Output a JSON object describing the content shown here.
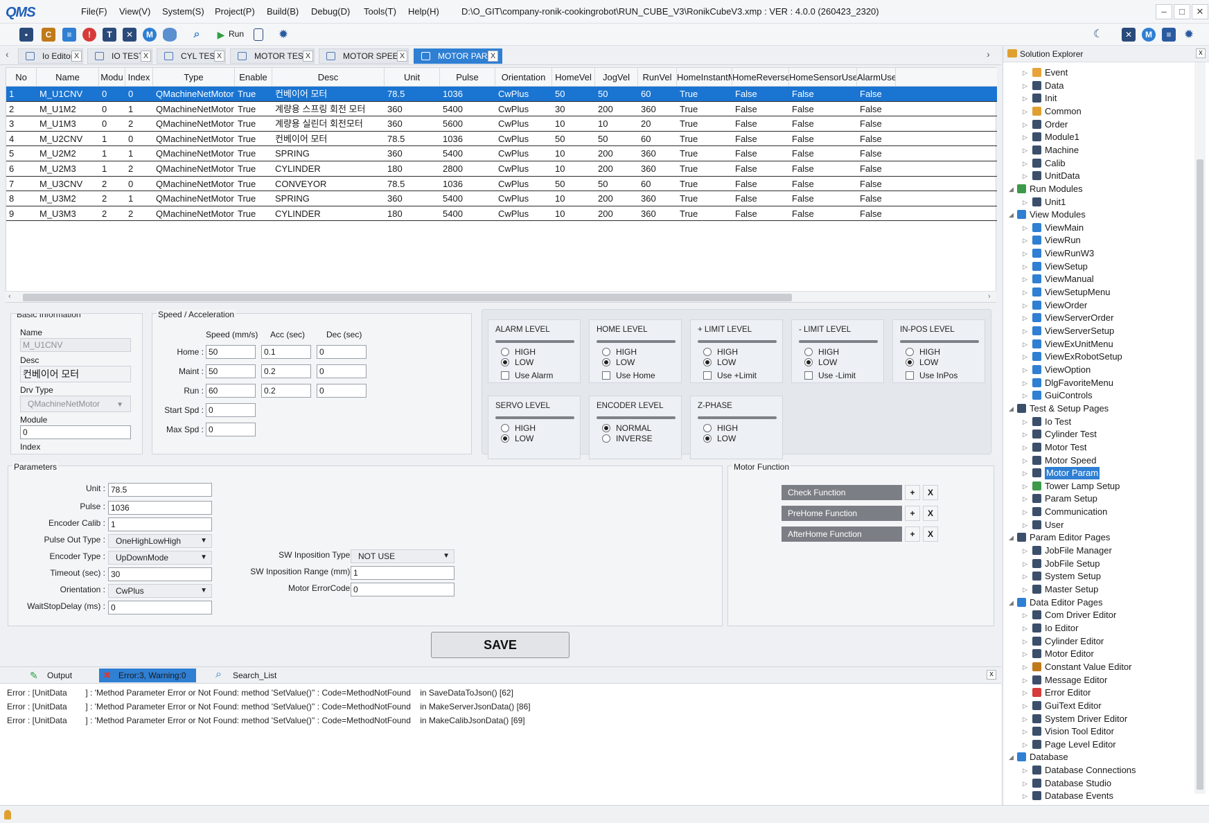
{
  "app": {
    "logo_text": "QMS",
    "title": "D:\\O_GIT\\company-ronik-cookingrobot\\RUN_CUBE_V3\\RonikCubeV3.xmp :  VER : 4.0.0 (260423_2320)",
    "menu": [
      "File(F)",
      "View(V)",
      "System(S)",
      "Project(P)",
      "Build(B)",
      "Debug(D)",
      "Tools(T)",
      "Help(H)"
    ],
    "window_buttons": [
      "–",
      "□",
      "✕"
    ],
    "accent_color": "#2f7fd3"
  },
  "toolbar": {
    "run_label": "Run",
    "icons": [
      "save-icon",
      "constant-icon",
      "message-icon",
      "error-icon",
      "text-icon",
      "close-box-icon",
      "motor-icon",
      "database-icon",
      "search-icon",
      "run-icon",
      "export-icon",
      "gear-icon"
    ],
    "right_icons": [
      "moon-icon",
      "close-box-icon",
      "motor-icon",
      "document-icon",
      "gear-icon"
    ]
  },
  "tabs": [
    {
      "label": "Io Editor",
      "close": "X"
    },
    {
      "label": "IO TEST",
      "close": "X"
    },
    {
      "label": "CYL TEST",
      "close": "X"
    },
    {
      "label": "MOTOR TEST",
      "close": "X"
    },
    {
      "label": "MOTOR SPEED",
      "close": "X"
    },
    {
      "label": "MOTOR PARA",
      "close": "X"
    }
  ],
  "grid": {
    "columns": [
      "No",
      "Name",
      "Modu",
      "Index",
      "Type",
      "Enable",
      "Desc",
      "Unit",
      "Pulse",
      "Orientation",
      "HomeVel",
      "JogVel",
      "RunVel",
      "HomeInstantM",
      "HomeReverse",
      "HomeSensorUse",
      "AlarmUse"
    ],
    "rows": [
      [
        "1",
        "M_U1CNV",
        "0",
        "0",
        "QMachineNetMotor",
        "True",
        "컨베이어 모터",
        "78.5",
        "1036",
        "CwPlus",
        "50",
        "50",
        "60",
        "True",
        "False",
        "False",
        "False"
      ],
      [
        "2",
        "M_U1M2",
        "0",
        "1",
        "QMachineNetMotor",
        "True",
        "계량용 스프링 회전 모터",
        "360",
        "5400",
        "CwPlus",
        "30",
        "200",
        "360",
        "True",
        "False",
        "False",
        "False"
      ],
      [
        "3",
        "M_U1M3",
        "0",
        "2",
        "QMachineNetMotor",
        "True",
        "계량용 실린더 회전모터",
        "360",
        "5600",
        "CwPlus",
        "10",
        "10",
        "20",
        "True",
        "False",
        "False",
        "False"
      ],
      [
        "4",
        "M_U2CNV",
        "1",
        "0",
        "QMachineNetMotor",
        "True",
        "컨베이어 모터",
        "78.5",
        "1036",
        "CwPlus",
        "50",
        "50",
        "60",
        "True",
        "False",
        "False",
        "False"
      ],
      [
        "5",
        "M_U2M2",
        "1",
        "1",
        "QMachineNetMotor",
        "True",
        "SPRING",
        "360",
        "5400",
        "CwPlus",
        "10",
        "200",
        "360",
        "True",
        "False",
        "False",
        "False"
      ],
      [
        "6",
        "M_U2M3",
        "1",
        "2",
        "QMachineNetMotor",
        "True",
        "CYLINDER",
        "180",
        "2800",
        "CwPlus",
        "10",
        "200",
        "360",
        "True",
        "False",
        "False",
        "False"
      ],
      [
        "7",
        "M_U3CNV",
        "2",
        "0",
        "QMachineNetMotor",
        "True",
        "CONVEYOR",
        "78.5",
        "1036",
        "CwPlus",
        "50",
        "50",
        "60",
        "True",
        "False",
        "False",
        "False"
      ],
      [
        "8",
        "M_U3M2",
        "2",
        "1",
        "QMachineNetMotor",
        "True",
        "SPRING",
        "360",
        "5400",
        "CwPlus",
        "10",
        "200",
        "360",
        "True",
        "False",
        "False",
        "False"
      ],
      [
        "9",
        "M_U3M3",
        "2",
        "2",
        "QMachineNetMotor",
        "True",
        "CYLINDER",
        "180",
        "5400",
        "CwPlus",
        "10",
        "200",
        "360",
        "True",
        "False",
        "False",
        "False"
      ]
    ]
  },
  "basic": {
    "title": "Basic Information",
    "name_label": "Name",
    "name_value": "M_U1CNV",
    "desc_label": "Desc",
    "desc_value": "컨베이어 모터",
    "drv_label": "Drv Type",
    "drv_value": "QMachineNetMotor",
    "module_label": "Module",
    "module_value": "0",
    "index_label": "Index"
  },
  "speed": {
    "title": "Speed / Acceleration",
    "col_speed": "Speed (mm/s)",
    "col_acc": "Acc (sec)",
    "col_dec": "Dec (sec)",
    "rows": [
      {
        "label": "Home :",
        "speed": "50",
        "acc": "0.1",
        "dec": "0"
      },
      {
        "label": "Maint :",
        "speed": "50",
        "acc": "0.2",
        "dec": "0"
      },
      {
        "label": "Run :",
        "speed": "60",
        "acc": "0.2",
        "dec": "0"
      }
    ],
    "start_label": "Start Spd :",
    "start_value": "0",
    "max_label": "Max Spd :",
    "max_value": "0"
  },
  "levels": [
    {
      "title": "ALARM LEVEL",
      "opt1": "HIGH",
      "opt2": "LOW",
      "selected": 2,
      "check": "Use Alarm"
    },
    {
      "title": "HOME LEVEL",
      "opt1": "HIGH",
      "opt2": "LOW",
      "selected": 2,
      "check": "Use Home"
    },
    {
      "title": "+ LIMIT LEVEL",
      "opt1": "HIGH",
      "opt2": "LOW",
      "selected": 2,
      "check": "Use +Limit"
    },
    {
      "title": "- LIMIT LEVEL",
      "opt1": "HIGH",
      "opt2": "LOW",
      "selected": 2,
      "check": "Use -Limit"
    },
    {
      "title": "IN-POS LEVEL",
      "opt1": "HIGH",
      "opt2": "LOW",
      "selected": 2,
      "check": "Use InPos"
    },
    {
      "title": "SERVO LEVEL",
      "opt1": "HIGH",
      "opt2": "LOW",
      "selected": 2,
      "check": ""
    },
    {
      "title": "ENCODER LEVEL",
      "opt1": "NORMAL",
      "opt2": "INVERSE",
      "selected": 1,
      "check": ""
    },
    {
      "title": "Z-PHASE",
      "opt1": "HIGH",
      "opt2": "LOW",
      "selected": 2,
      "check": ""
    }
  ],
  "params": {
    "title": "Parameters",
    "unit_label": "Unit :",
    "unit_value": "78.5",
    "pulse_label": "Pulse :",
    "pulse_value": "1036",
    "enc_calib_label": "Encoder Calib :",
    "enc_calib_value": "1",
    "pulse_out_label": "Pulse Out Type :",
    "pulse_out_value": "OneHighLowHigh",
    "enc_type_label": "Encoder Type :",
    "enc_type_value": "UpDownMode",
    "timeout_label": "Timeout (sec) :",
    "timeout_value": "30",
    "orient_label": "Orientation :",
    "orient_value": "CwPlus",
    "wait_label": "WaitStopDelay (ms) :",
    "wait_value": "0",
    "sw_type_label": "SW Inposition Type :",
    "sw_type_value": "NOT USE",
    "sw_range_label": "SW Inposition Range (mm) :",
    "sw_range_value": "1",
    "err_label": "Motor ErrorCode :",
    "err_value": "0"
  },
  "motor_function": {
    "title": "Motor Function",
    "items": [
      "Check Function",
      "PreHome Function",
      "AfterHome Function"
    ],
    "add": "+",
    "remove": "X"
  },
  "save_label": "SAVE",
  "output": {
    "tabs": [
      "Output",
      "Error:3, Warning:0",
      "Search_List"
    ],
    "close": "x",
    "lines": [
      "Error : [UnitData        ] : 'Method Parameter Error or Not Found: method 'SetValue()'' : Code=MethodNotFound    in SaveDataToJson() [62]",
      "Error : [UnitData        ] : 'Method Parameter Error or Not Found: method 'SetValue()'' : Code=MethodNotFound    in MakeServerJsonData() [86]",
      "Error : [UnitData        ] : 'Method Parameter Error or Not Found: method 'SetValue()'' : Code=MethodNotFound    in MakeCalibJsonData() [69]"
    ]
  },
  "solution": {
    "title": "Solution Explorer",
    "close": "x",
    "items": [
      {
        "label": "Event",
        "icon": "lightning-icon",
        "color": "#e8a23a",
        "level": 1
      },
      {
        "label": "Data",
        "icon": "list-icon",
        "color": "#3b4f6b",
        "level": 1
      },
      {
        "label": "Init",
        "icon": "list-icon",
        "color": "#3b4f6b",
        "level": 1
      },
      {
        "label": "Common",
        "icon": "columns-icon",
        "color": "#e0a030",
        "level": 1
      },
      {
        "label": "Order",
        "icon": "list-icon",
        "color": "#3b4f6b",
        "level": 1
      },
      {
        "label": "Module1",
        "icon": "list-icon",
        "color": "#3b4f6b",
        "level": 1
      },
      {
        "label": "Machine",
        "icon": "list-icon",
        "color": "#3b4f6b",
        "level": 1
      },
      {
        "label": "Calib",
        "icon": "list-icon",
        "color": "#3b4f6b",
        "level": 1
      },
      {
        "label": "UnitData",
        "icon": "list-icon",
        "color": "#3b4f6b",
        "level": 1
      },
      {
        "label": "Run Modules",
        "icon": "check-folder-icon",
        "color": "#3d9a4a",
        "level": 0
      },
      {
        "label": "Unit1",
        "icon": "list-icon",
        "color": "#3b4f6b",
        "level": 1
      },
      {
        "label": "View Modules",
        "icon": "window-icon",
        "color": "#2f7fd3",
        "level": 0
      },
      {
        "label": "ViewMain",
        "icon": "window-icon",
        "color": "#2f7fd3",
        "level": 1
      },
      {
        "label": "ViewRun",
        "icon": "window-icon",
        "color": "#2f7fd3",
        "level": 1
      },
      {
        "label": "ViewRunW3",
        "icon": "window-icon",
        "color": "#2f7fd3",
        "level": 1
      },
      {
        "label": "ViewSetup",
        "icon": "window-icon",
        "color": "#2f7fd3",
        "level": 1
      },
      {
        "label": "ViewManual",
        "icon": "window-icon",
        "color": "#2f7fd3",
        "level": 1
      },
      {
        "label": "ViewSetupMenu",
        "icon": "window-icon",
        "color": "#2f7fd3",
        "level": 1
      },
      {
        "label": "ViewOrder",
        "icon": "window-icon",
        "color": "#2f7fd3",
        "level": 1
      },
      {
        "label": "ViewServerOrder",
        "icon": "window-icon",
        "color": "#2f7fd3",
        "level": 1
      },
      {
        "label": "ViewServerSetup",
        "icon": "window-icon",
        "color": "#2f7fd3",
        "level": 1
      },
      {
        "label": "ViewExUnitMenu",
        "icon": "window-icon",
        "color": "#2f7fd3",
        "level": 1
      },
      {
        "label": "ViewExRobotSetup",
        "icon": "window-icon",
        "color": "#2f7fd3",
        "level": 1
      },
      {
        "label": "ViewOption",
        "icon": "window-icon",
        "color": "#2f7fd3",
        "level": 1
      },
      {
        "label": "DlgFavoriteMenu",
        "icon": "window-icon",
        "color": "#2f7fd3",
        "level": 1
      },
      {
        "label": "GuiControls",
        "icon": "window-icon",
        "color": "#2f7fd3",
        "level": 1
      },
      {
        "label": "Test & Setup Pages",
        "icon": "list-icon",
        "color": "#3b4f6b",
        "level": 0
      },
      {
        "label": "Io Test",
        "icon": "page-icon",
        "color": "#3b4f6b",
        "level": 1
      },
      {
        "label": "Cylinder Test",
        "icon": "page-icon",
        "color": "#3b4f6b",
        "level": 1
      },
      {
        "label": "Motor Test",
        "icon": "motor-icon",
        "color": "#3b4f6b",
        "level": 1
      },
      {
        "label": "Motor Speed",
        "icon": "motor-icon",
        "color": "#3b4f6b",
        "level": 1
      },
      {
        "label": "Motor Param",
        "icon": "clock-icon",
        "color": "#3b4f6b",
        "level": 1,
        "selected": true
      },
      {
        "label": "Tower Lamp Setup",
        "icon": "tower-lamp-icon",
        "color": "#3d9a4a",
        "level": 1
      },
      {
        "label": "Param Setup",
        "icon": "page-icon",
        "color": "#3b4f6b",
        "level": 1
      },
      {
        "label": "Communication",
        "icon": "cable-icon",
        "color": "#3b4f6b",
        "level": 1
      },
      {
        "label": "User",
        "icon": "user-icon",
        "color": "#3b4f6b",
        "level": 1
      },
      {
        "label": "Param Editor Pages",
        "icon": "list-icon",
        "color": "#3b4f6b",
        "level": 0
      },
      {
        "label": "JobFile Manager",
        "icon": "page-icon",
        "color": "#3b4f6b",
        "level": 1
      },
      {
        "label": "JobFile Setup",
        "icon": "page-icon",
        "color": "#3b4f6b",
        "level": 1
      },
      {
        "label": "System Setup",
        "icon": "page-icon",
        "color": "#3b4f6b",
        "level": 1
      },
      {
        "label": "Master Setup",
        "icon": "page-icon",
        "color": "#3b4f6b",
        "level": 1
      },
      {
        "label": "Data Editor Pages",
        "icon": "check-box-icon",
        "color": "#2f7fd3",
        "level": 0
      },
      {
        "label": "Com Driver Editor",
        "icon": "cable-icon",
        "color": "#3b4f6b",
        "level": 1
      },
      {
        "label": "Io Editor",
        "icon": "close-box-icon",
        "color": "#3b4f6b",
        "level": 1
      },
      {
        "label": "Cylinder Editor",
        "icon": "page-icon",
        "color": "#3b4f6b",
        "level": 1
      },
      {
        "label": "Motor Editor",
        "icon": "motor-icon",
        "color": "#3b4f6b",
        "level": 1
      },
      {
        "label": "Constant Value Editor",
        "icon": "constant-icon",
        "color": "#c07a1a",
        "level": 1
      },
      {
        "label": "Message Editor",
        "icon": "message-icon",
        "color": "#3b4f6b",
        "level": 1
      },
      {
        "label": "Error Editor",
        "icon": "error-icon",
        "color": "#d63a3a",
        "level": 1
      },
      {
        "label": "GuiText Editor",
        "icon": "text-icon",
        "color": "#3b4f6b",
        "level": 1
      },
      {
        "label": "System Driver Editor",
        "icon": "gear-icon",
        "color": "#3b4f6b",
        "level": 1
      },
      {
        "label": "Vision Tool Editor",
        "icon": "page-icon",
        "color": "#3b4f6b",
        "level": 1
      },
      {
        "label": "Page Level Editor",
        "icon": "user-icon",
        "color": "#3b4f6b",
        "level": 1
      },
      {
        "label": "Database",
        "icon": "check-box-icon",
        "color": "#2f7fd3",
        "level": 0
      },
      {
        "label": "Database Connections",
        "icon": "cube-icon",
        "color": "#3b4f6b",
        "level": 1
      },
      {
        "label": "Database Studio",
        "icon": "cube-icon",
        "color": "#3b4f6b",
        "level": 1
      },
      {
        "label": "Database Events",
        "icon": "cube-icon",
        "color": "#3b4f6b",
        "level": 1
      }
    ]
  }
}
